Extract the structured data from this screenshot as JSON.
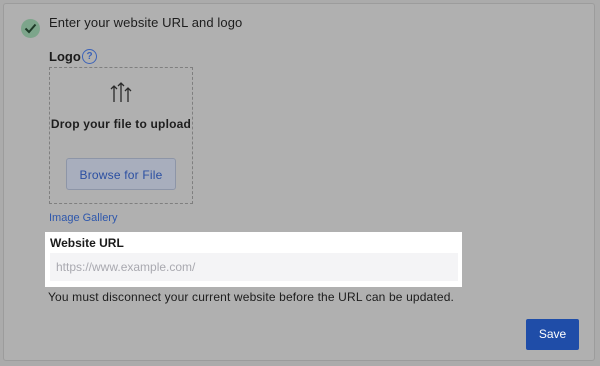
{
  "step": {
    "title": "Enter your website URL and logo",
    "status": "complete",
    "check_icon": "check-icon"
  },
  "logo": {
    "label": "Logo",
    "help_icon": "question-circle-icon",
    "help_glyph": "?",
    "dropzone": {
      "icon": "upload-arrows-icon",
      "text": "Drop your file to upload",
      "browse_label": "Browse for File"
    },
    "gallery_link": "Image Gallery"
  },
  "website": {
    "label": "Website URL",
    "value": "",
    "placeholder": "https://www.example.com/",
    "note": "You must disconnect your current website before the URL can be updated."
  },
  "actions": {
    "save_label": "Save"
  },
  "colors": {
    "accent": "#1f4da8",
    "link": "#2e57ac",
    "success": "#7da58b",
    "overlay": "#ababab"
  }
}
